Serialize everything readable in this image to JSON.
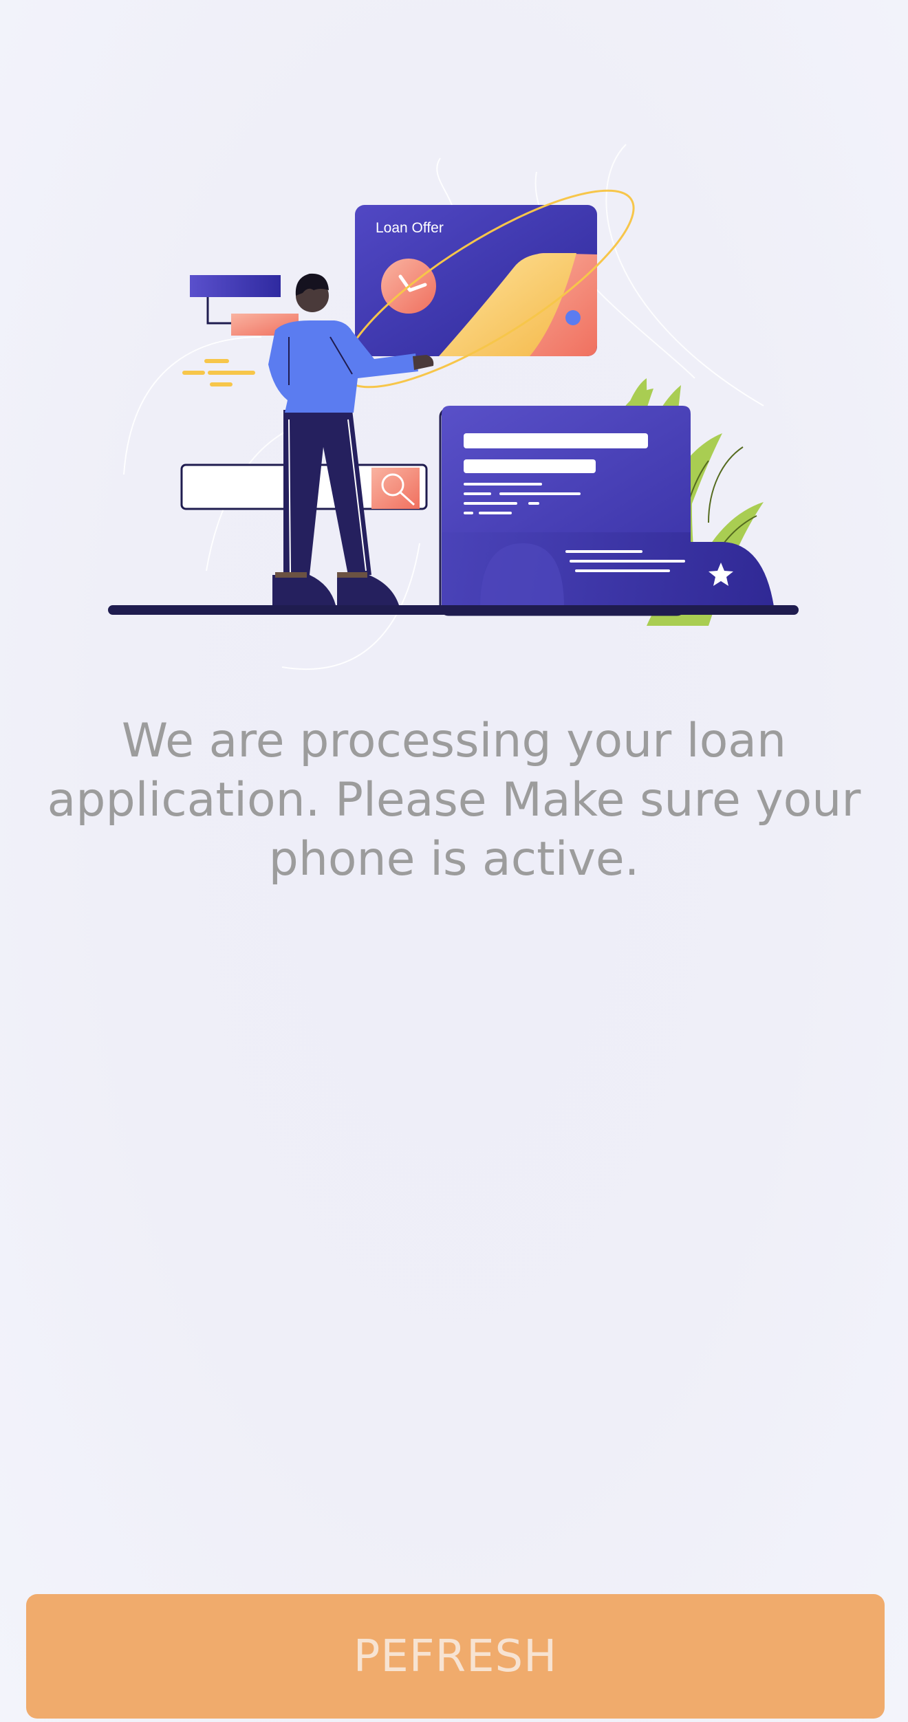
{
  "illustration": {
    "card_title": "Loan Offer"
  },
  "message": "We are processing your loan application. Please Make sure your phone is active.",
  "refresh_button": {
    "label": "PEFRESH"
  },
  "colors": {
    "background": "#efeff8",
    "message_text": "#9c9c9c",
    "button_bg": "#f0ab6c",
    "button_text": "#f7e3d2",
    "indigo": "#3c35ad",
    "person_shirt": "#5b7cf0",
    "person_pants": "#25205e",
    "accent_coral": "#f5806b",
    "accent_yellow": "#f7c64a",
    "leaf_green": "#a9cd52"
  }
}
